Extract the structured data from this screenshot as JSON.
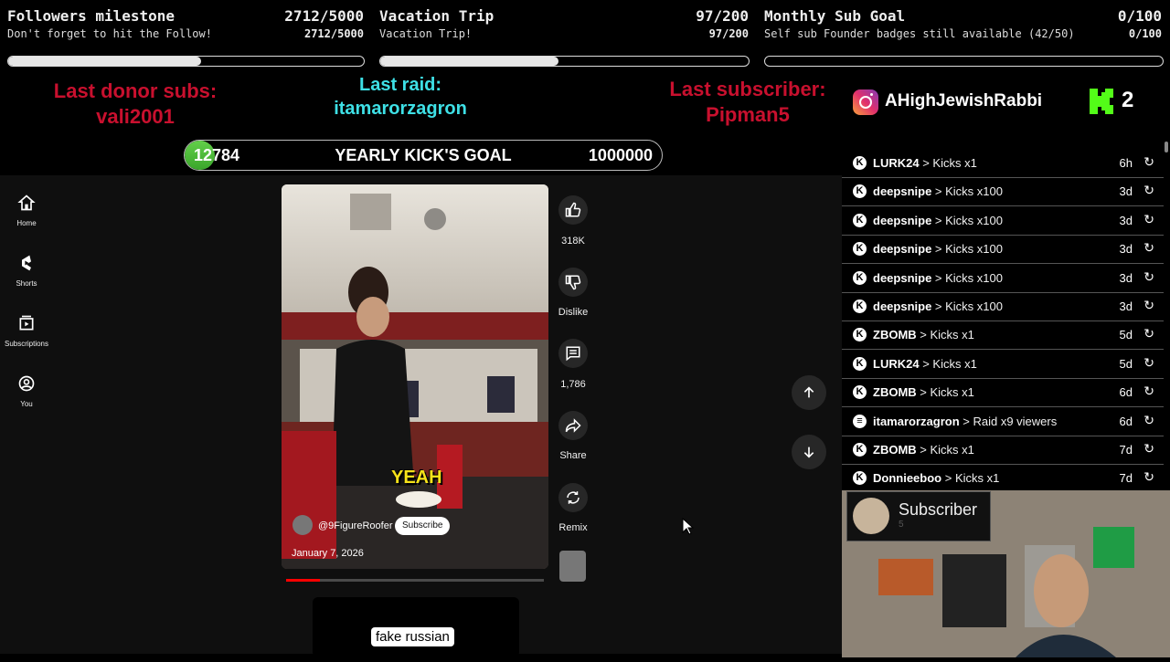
{
  "goals": [
    {
      "title": "Followers milestone",
      "count": "2712/5000",
      "sub": "Don't forget to hit the Follow!",
      "sub_count": "2712/5000",
      "progress": 0.5424
    },
    {
      "title": "Vacation Trip",
      "count": "97/200",
      "sub": "Vacation Trip!",
      "sub_count": "97/200",
      "progress": 0.485
    },
    {
      "title": "Monthly Sub Goal",
      "count": "0/100",
      "sub": "Self sub Founder badges still available (42/50)",
      "sub_count": "0/100",
      "progress": 0
    }
  ],
  "last_donor": {
    "label": "Last donor subs:",
    "name": "vali2001"
  },
  "last_raid": {
    "label": "Last raid:",
    "name": "itamarorzagron"
  },
  "last_subscriber": {
    "label": "Last subscriber:",
    "name": "Pipman5"
  },
  "instagram": {
    "handle": "AHighJewishRabbi",
    "icon": "instagram-icon"
  },
  "kick_badge": {
    "count": "2",
    "icon": "kick-logo-icon"
  },
  "kick_goal": {
    "current": "12784",
    "label": "YEARLY KICK'S GOAL",
    "target": "1000000",
    "progress": 0.012784
  },
  "yt_nav": [
    {
      "label": "Home",
      "icon": "home-icon"
    },
    {
      "label": "Shorts",
      "icon": "shorts-icon"
    },
    {
      "label": "Subscriptions",
      "icon": "subscriptions-icon"
    },
    {
      "label": "You",
      "icon": "account-icon"
    }
  ],
  "short": {
    "caption": "YEAH",
    "channel": "@9FigureRoofer",
    "subscribe": "Subscribe",
    "date": "January 7, 2026",
    "next_caption": "fake russian",
    "progress": 0.13
  },
  "actions": {
    "like": "318K",
    "dislike": "Dislike",
    "comments": "1,786",
    "share": "Share",
    "remix": "Remix"
  },
  "events": [
    {
      "name": "LURK24",
      "text": "> Kicks x1",
      "time": "6h",
      "icon": "kick-icon"
    },
    {
      "name": "deepsnipe",
      "text": "> Kicks x100",
      "time": "3d",
      "icon": "kick-icon"
    },
    {
      "name": "deepsnipe",
      "text": "> Kicks x100",
      "time": "3d",
      "icon": "kick-icon"
    },
    {
      "name": "deepsnipe",
      "text": "> Kicks x100",
      "time": "3d",
      "icon": "kick-icon"
    },
    {
      "name": "deepsnipe",
      "text": "> Kicks x100",
      "time": "3d",
      "icon": "kick-icon"
    },
    {
      "name": "deepsnipe",
      "text": "> Kicks x100",
      "time": "3d",
      "icon": "kick-icon"
    },
    {
      "name": "ZBOMB",
      "text": "> Kicks x1",
      "time": "5d",
      "icon": "kick-icon"
    },
    {
      "name": "LURK24",
      "text": "> Kicks x1",
      "time": "5d",
      "icon": "kick-icon"
    },
    {
      "name": "ZBOMB",
      "text": "> Kicks x1",
      "time": "6d",
      "icon": "kick-icon"
    },
    {
      "name": "itamarorzagron",
      "text": "> Raid x9 viewers",
      "time": "6d",
      "icon": "raid-icon"
    },
    {
      "name": "ZBOMB",
      "text": "> Kicks x1",
      "time": "7d",
      "icon": "kick-icon"
    },
    {
      "name": "Donnieeboo",
      "text": "> Kicks x1",
      "time": "7d",
      "icon": "kick-icon"
    }
  ],
  "subscriber_badge": {
    "label": "Subscriber",
    "count": "5"
  },
  "colors": {
    "red": "#c8102e",
    "cyan": "#3ee0e6",
    "kick_green": "#53fc18",
    "bar_fill": "#e6e6e6"
  }
}
